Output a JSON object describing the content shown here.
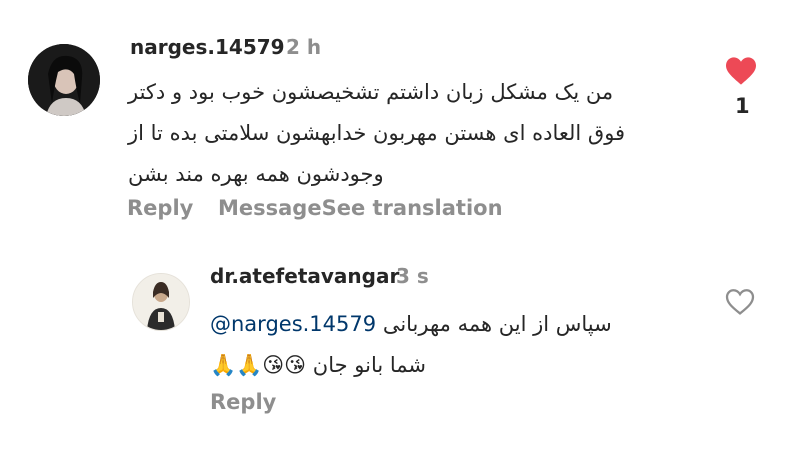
{
  "comments": [
    {
      "username": "narges.14579",
      "time": "2 h",
      "lines": [
        "من یک مشکل زبان داشتم  تشخیصشون خوب بود و دکتر",
        "فوق العاده ای هستن مهربون  خدابهشون سلامتی بده تا از",
        "وجودشون همه بهره مند بشن"
      ],
      "reply_label": "Reply",
      "message_label": "Message",
      "translate_label": "See translation",
      "like_count": "1",
      "liked": true,
      "like_color": "#ed4956"
    },
    {
      "username": "dr.atefetavangar",
      "time": "3 s",
      "mention": "@narges.14579",
      "line1_text": "سپاس از این همه مهربانی",
      "line2_text": "شما بانو جان",
      "line2_emoji": "🙏🙏😘😘",
      "reply_label": "Reply",
      "liked": false
    }
  ]
}
